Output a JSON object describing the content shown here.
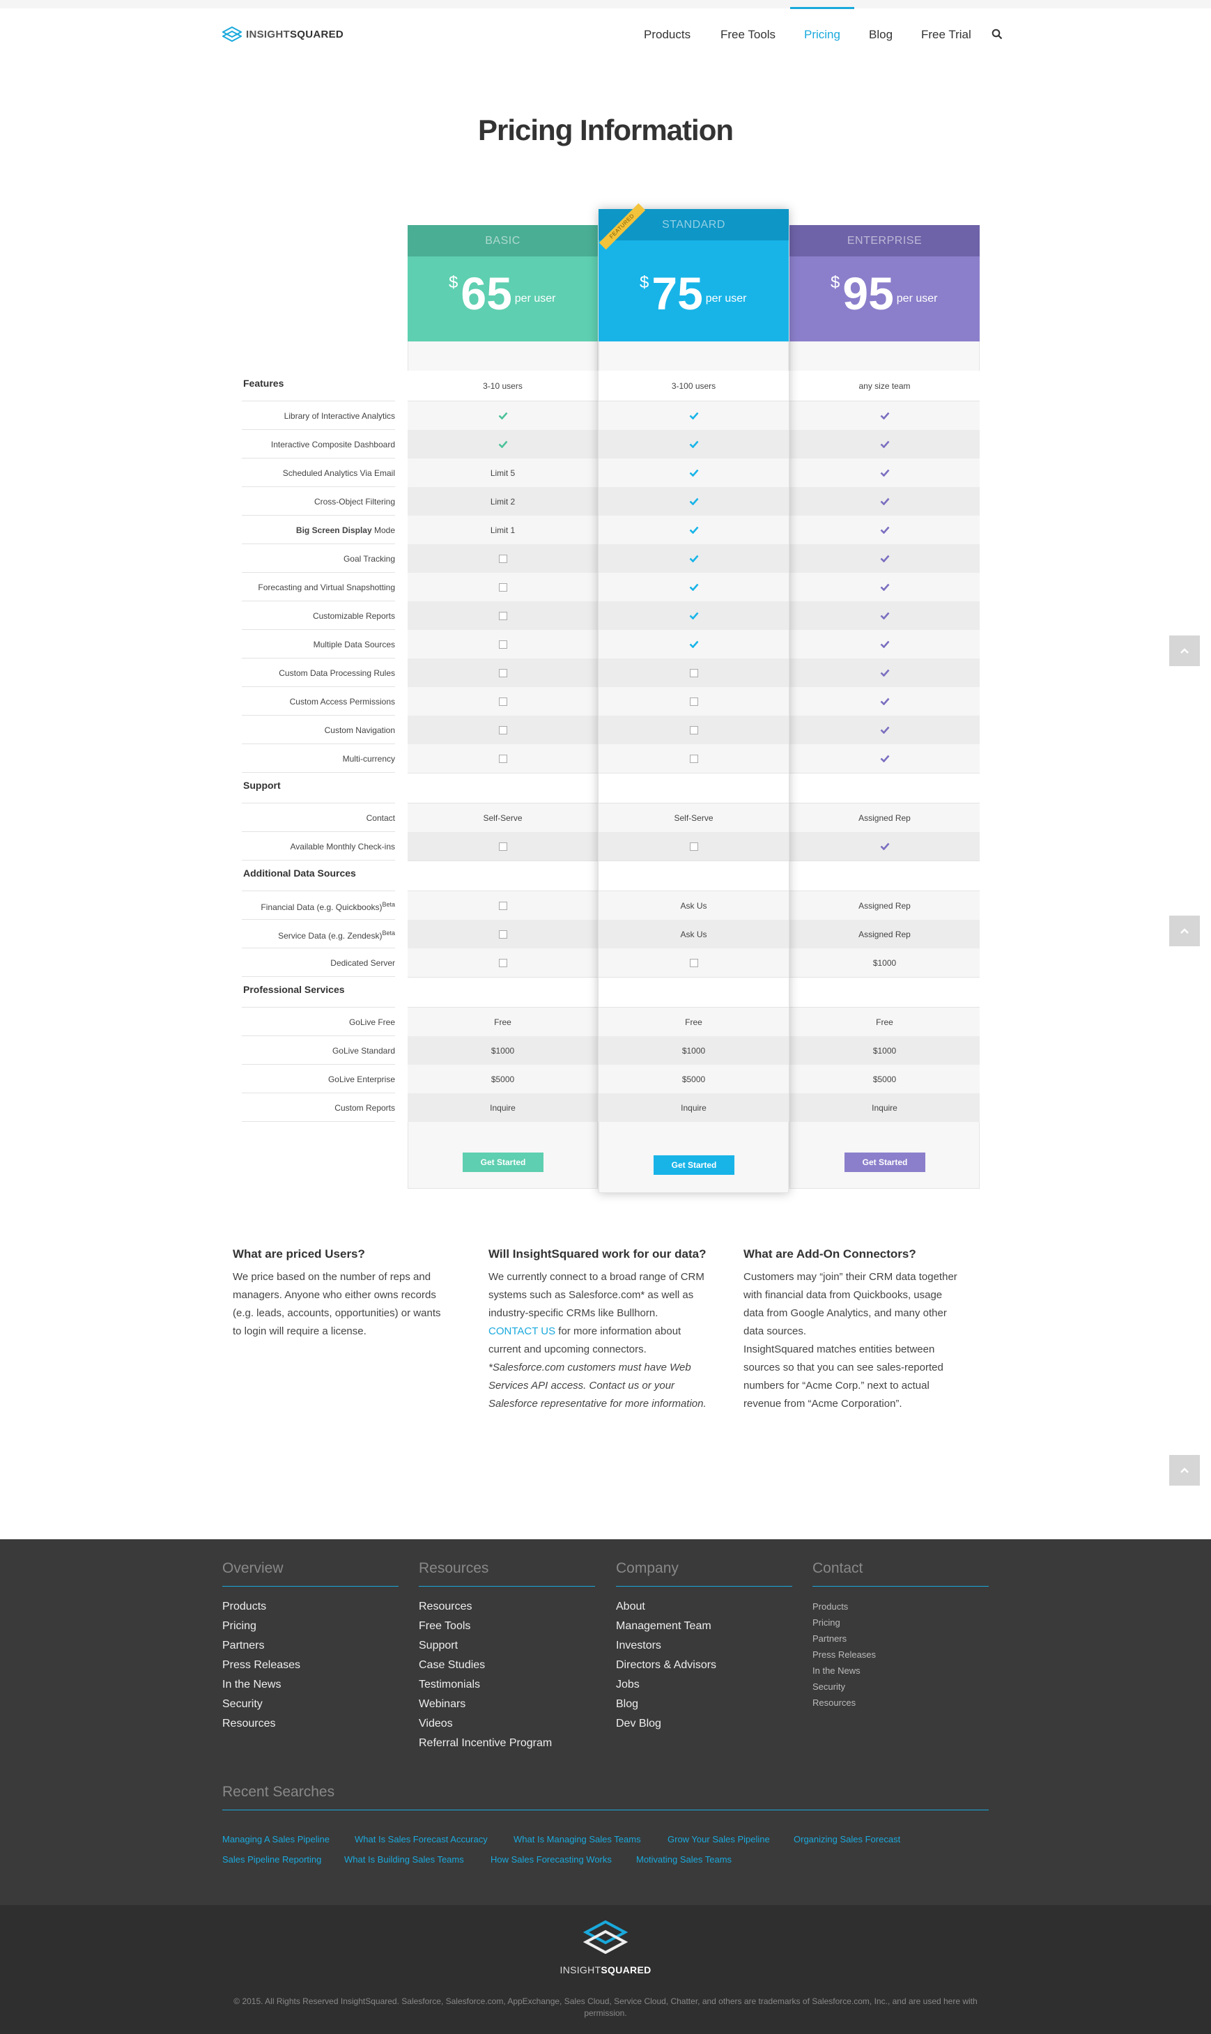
{
  "header": {
    "logo_prefix": "INSIGHT",
    "logo_suffix": "SQUARED",
    "nav": [
      {
        "label": "Products"
      },
      {
        "label": "Free Tools"
      },
      {
        "label": "Pricing"
      },
      {
        "label": "Blog"
      },
      {
        "label": "Free Trial"
      }
    ],
    "active": "Pricing"
  },
  "page_title": "Pricing Information",
  "plans": [
    {
      "name": "BASIC",
      "currency": "$",
      "price": "65",
      "unit": "per user",
      "team": "3-10 users",
      "cta": "Get Started",
      "color": "#5ecfb0",
      "header_color": "#4aae94"
    },
    {
      "name": "STANDARD",
      "currency": "$",
      "price": "75",
      "unit": "per user",
      "team": "3-100 users",
      "cta": "Get Started",
      "color": "#18b4e8",
      "header_color": "#0e96c6",
      "ribbon": "FEATURED"
    },
    {
      "name": "ENTERPRISE",
      "currency": "$",
      "price": "95",
      "unit": "per user",
      "team": "any size team",
      "cta": "Get Started",
      "color": "#8b7fcb",
      "header_color": "#6e63a8"
    }
  ],
  "sections": [
    {
      "title": "Features",
      "rows": [
        {
          "label": "Library of Interactive Analytics",
          "values": [
            "check",
            "check",
            "check"
          ]
        },
        {
          "label": "Interactive Composite Dashboard",
          "values": [
            "check",
            "check",
            "check"
          ]
        },
        {
          "label": "Scheduled Analytics Via Email",
          "values": [
            "Limit 5",
            "check",
            "check"
          ]
        },
        {
          "label": "Cross-Object Filtering",
          "values": [
            "Limit 2",
            "check",
            "check"
          ]
        },
        {
          "label": "Big Screen Display Mode",
          "label_bold": "Big Screen Display",
          "label_rest": " Mode",
          "values": [
            "Limit 1",
            "check",
            "check"
          ]
        },
        {
          "label": "Goal Tracking",
          "values": [
            "box",
            "check",
            "check"
          ]
        },
        {
          "label": "Forecasting and Virtual Snapshotting",
          "values": [
            "box",
            "check",
            "check"
          ]
        },
        {
          "label": "Customizable Reports",
          "values": [
            "box",
            "check",
            "check"
          ]
        },
        {
          "label": "Multiple Data Sources",
          "values": [
            "box",
            "check",
            "check"
          ]
        },
        {
          "label": "Custom Data Processing Rules",
          "values": [
            "box",
            "box",
            "check"
          ]
        },
        {
          "label": "Custom Access Permissions",
          "values": [
            "box",
            "box",
            "check"
          ]
        },
        {
          "label": "Custom Navigation",
          "values": [
            "box",
            "box",
            "check"
          ]
        },
        {
          "label": "Multi-currency",
          "values": [
            "box",
            "box",
            "check"
          ]
        }
      ]
    },
    {
      "title": "Support",
      "rows": [
        {
          "label": "Contact",
          "values": [
            "Self-Serve",
            "Self-Serve",
            "Assigned Rep"
          ]
        },
        {
          "label": "Available Monthly Check-ins",
          "values": [
            "box",
            "box",
            "check"
          ]
        }
      ]
    },
    {
      "title": "Additional Data Sources",
      "rows": [
        {
          "label": "Financial Data (e.g. Quickbooks)",
          "sup": "Beta",
          "values": [
            "box",
            "Ask Us",
            "Assigned Rep"
          ]
        },
        {
          "label": "Service Data (e.g. Zendesk)",
          "sup": "Beta",
          "values": [
            "box",
            "Ask Us",
            "Assigned Rep"
          ]
        },
        {
          "label": "Dedicated Server",
          "values": [
            "box",
            "box",
            "$1000"
          ]
        }
      ]
    },
    {
      "title": "Professional Services",
      "rows": [
        {
          "label": "GoLive Free",
          "values": [
            "Free",
            "Free",
            "Free"
          ]
        },
        {
          "label": "GoLive Standard",
          "values": [
            "$1000",
            "$1000",
            "$1000"
          ]
        },
        {
          "label": "GoLive Enterprise",
          "values": [
            "$5000",
            "$5000",
            "$5000"
          ]
        },
        {
          "label": "Custom Reports",
          "values": [
            "Inquire",
            "Inquire",
            "Inquire"
          ]
        }
      ]
    }
  ],
  "faq": [
    {
      "title": "What are priced Users?",
      "lines": [
        "We price based on the number of reps and",
        "managers. Anyone who either owns records",
        "(e.g. leads, accounts, opportunities) or wants",
        "to login will require a license."
      ]
    },
    {
      "title": "Will InsightSquared work for our data?",
      "lines": [
        "We currently connect to a broad range of CRM",
        "systems such as Salesforce.com* as well as",
        "industry-specific CRMs like Bullhorn."
      ],
      "link": "CONTACT US",
      "after_link": " for more information about",
      "lines2": [
        "current and upcoming connectors."
      ],
      "italic": [
        "*Salesforce.com customers must have Web",
        "Services API access. Contact us or your",
        "Salesforce representative for more information."
      ]
    },
    {
      "title": "What are Add-On Connectors?",
      "lines": [
        "Customers may “join” their CRM data together",
        "with financial data from Quickbooks, usage",
        "data from Google Analytics, and many other",
        "data sources.",
        "InsightSquared matches entities between",
        "sources so that you can see sales-reported",
        "numbers for “Acme Corp.” next to actual",
        "revenue from “Acme Corporation”."
      ]
    }
  ],
  "footer": {
    "columns": [
      {
        "title": "Overview",
        "links": [
          "Products",
          "Pricing",
          "Partners",
          "Press Releases",
          "In the News",
          "Security",
          "Resources"
        ]
      },
      {
        "title": "Resources",
        "links": [
          "Resources",
          "Free Tools",
          "Support",
          "Case Studies",
          "Testimonials",
          "Webinars",
          "Videos",
          "Referral Incentive Program"
        ]
      },
      {
        "title": "Company",
        "links": [
          "About",
          "Management Team",
          "Investors",
          "Directors & Advisors",
          "Jobs",
          "Blog",
          "Dev Blog"
        ]
      },
      {
        "title": "Contact",
        "links": [
          "Products",
          "Pricing",
          "Partners",
          "Press Releases",
          "In the News",
          "Security",
          "Resources"
        ]
      }
    ],
    "recent_title": "Recent Searches",
    "recent_row1": [
      "Managing A Sales Pipeline",
      "What Is Sales Forecast Accuracy",
      "What Is Managing Sales Teams",
      "Grow Your Sales Pipeline",
      "Organizing Sales Forecast"
    ],
    "recent_row2": [
      "Sales Pipeline Reporting",
      "What Is Building Sales Teams",
      "How Sales Forecasting Works",
      "Motivating Sales Teams"
    ],
    "logo_prefix": "INSIGHT",
    "logo_suffix": "SQUARED",
    "copyright_1": "© 2015. All Rights Reserved InsightSquared. Salesforce, Salesforce.com, AppExchange, Sales Cloud, Service Cloud, Chatter, and others are trademarks of Salesforce.com, Inc., and are used here with",
    "copyright_2": "permission."
  },
  "colors": {
    "accent": "#1aa9dc",
    "check_basic": "#4cc29a",
    "check_standard": "#18b4e8",
    "check_enterprise": "#7a6fc0"
  }
}
